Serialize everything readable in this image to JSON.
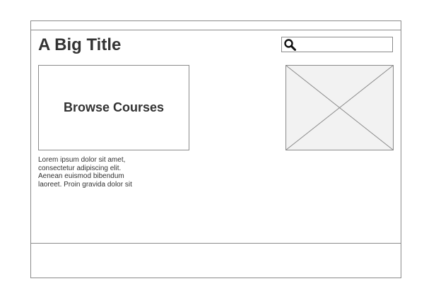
{
  "page": {
    "title": "A Big Title"
  },
  "search": {
    "placeholder": "",
    "value": "",
    "icon": "search-icon"
  },
  "hero": {
    "browse_label": "Browse Courses"
  },
  "content": {
    "body_text": "Lorem ipsum dolor sit amet, consectetur adipiscing elit. Aenean euismod bibendum laoreet. Proin gravida dolor sit"
  },
  "image": {
    "icon": "image-placeholder-icon"
  },
  "colors": {
    "border": "#8a8a8a",
    "text": "#333333",
    "placeholder_fill": "#f2f2f2"
  }
}
